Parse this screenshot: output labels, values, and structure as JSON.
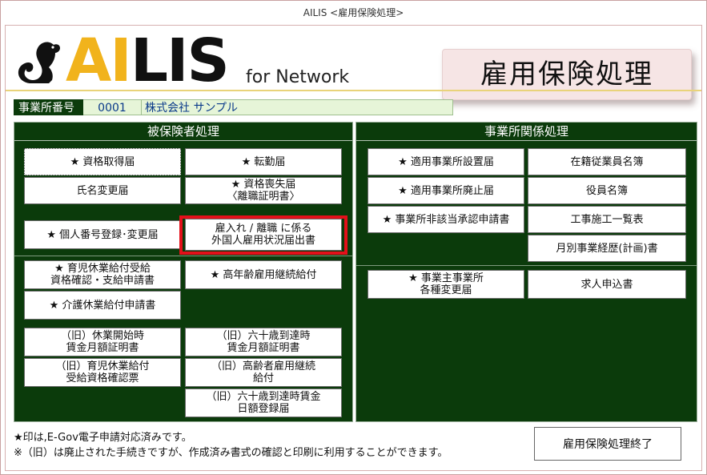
{
  "window": {
    "title": "AILIS <雇用保険処理>"
  },
  "logo": {
    "prefix": "AI",
    "suffix": "LIS",
    "sub": "for Network"
  },
  "banner": {
    "title": "雇用保険処理"
  },
  "office": {
    "label": "事業所番号",
    "code": "0001",
    "name": "株式会社 サンプル"
  },
  "left_panel": {
    "title": "被保険者処理",
    "buttons": [
      "★ 資格取得届",
      "★ 転勤届",
      "氏名変更届",
      "★ 資格喪失届\n〈離職証明書〉",
      "★ 個人番号登録･変更届",
      "雇入れ / 離職 に係る\n外国人雇用状況届出書",
      "★ 育児休業給付受給\n資格確認・支給申請書",
      "★ 高年齢雇用継続給付",
      "★ 介護休業給付申請書",
      "（旧）休業開始時\n賃金月額証明書",
      "（旧）六十歳到達時\n賃金月額証明書",
      "（旧）育児休業給付\n受給資格確認票",
      "（旧）高齢者雇用継続\n給付",
      "（旧）六十歳到達時賃金\n日額登録届"
    ]
  },
  "right_panel": {
    "title": "事業所関係処理",
    "buttons": [
      "★ 適用事業所設置届",
      "在籍従業員名簿",
      "★ 適用事業所廃止届",
      "役員名簿",
      "★ 事業所非該当承認申請書",
      "工事施工一覧表",
      "月別事業経歴(計画)書",
      "★ 事業主事業所\n各種変更届",
      "求人申込書"
    ]
  },
  "notes": {
    "line1": "★印は,E-Gov電子申請対応済みです。",
    "line2": "※（旧）は廃止された手続きですが、作成済み書式の確認と印刷に利用することができます。"
  },
  "footer": {
    "end_button": "雇用保険処理終了"
  },
  "colors": {
    "panel_bg": "#0b3b0b",
    "highlight": "#e3101a",
    "logo_accent": "#f1b31c"
  }
}
